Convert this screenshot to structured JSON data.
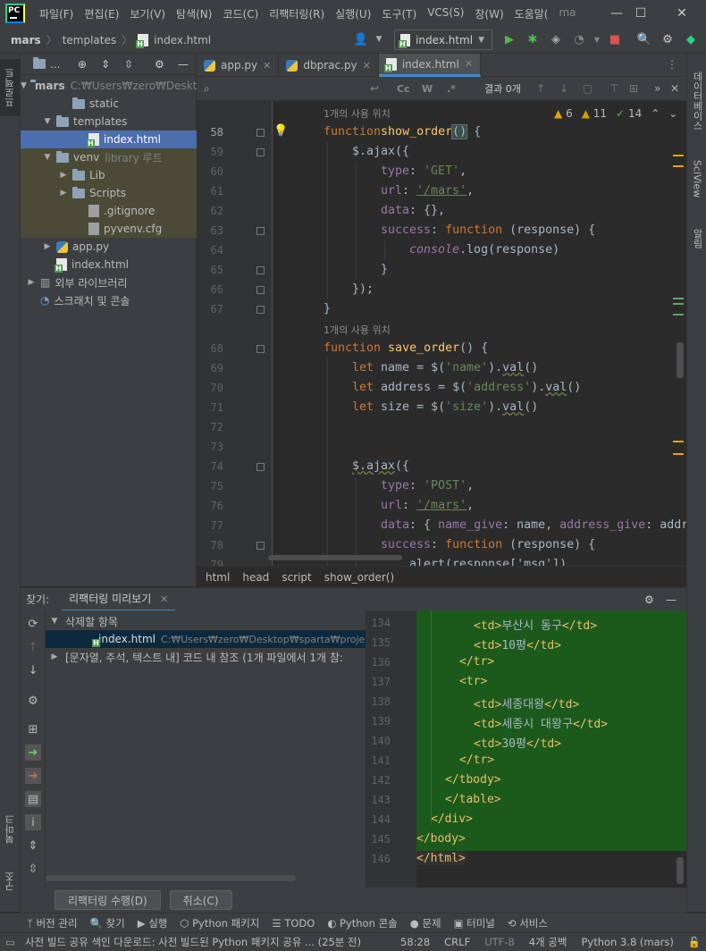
{
  "titlebar": {
    "logo": "PC",
    "menu": [
      "파일(F)",
      "편집(E)",
      "보기(V)",
      "탐색(N)",
      "코드(C)",
      "리팩터링(R)",
      "실행(U)",
      "도구(T)",
      "VCS(S)",
      "창(W)",
      "도움말(",
      "ma"
    ]
  },
  "navbar": {
    "crumbs": [
      "mars",
      "templates",
      "index.html"
    ],
    "run_config": "index.html"
  },
  "left_strip": {
    "project_tab": "프로젝트",
    "bookmark_tab": "북마크",
    "structure_tab": "구조"
  },
  "right_strip": {
    "db_tab": "데이터베이스",
    "sciview_tab": "SciView",
    "notify_tab": "알림"
  },
  "project": {
    "header_icon": "...",
    "tree": [
      {
        "label": "mars",
        "extra": "C:₩Users₩zero₩Deskt",
        "type": "folder",
        "depth": 0,
        "arrow": "▼"
      },
      {
        "label": "static",
        "extra": "",
        "type": "folder",
        "depth": 2,
        "arrow": ""
      },
      {
        "label": "templates",
        "extra": "",
        "type": "folder",
        "depth": 1,
        "arrow": "▼"
      },
      {
        "label": "index.html",
        "extra": "",
        "type": "html",
        "depth": 3,
        "arrow": "",
        "selected": true
      },
      {
        "label": "venv",
        "extra": "library 루트",
        "type": "folder",
        "depth": 1,
        "arrow": "▼",
        "venv": true
      },
      {
        "label": "Lib",
        "extra": "",
        "type": "folder",
        "depth": 2,
        "arrow": "▶",
        "venv": true
      },
      {
        "label": "Scripts",
        "extra": "",
        "type": "folder",
        "depth": 2,
        "arrow": "▶",
        "venv": true
      },
      {
        "label": ".gitignore",
        "extra": "",
        "type": "gen",
        "depth": 3,
        "arrow": "",
        "venv": true
      },
      {
        "label": "pyvenv.cfg",
        "extra": "",
        "type": "gen",
        "depth": 3,
        "arrow": "",
        "venv": true
      },
      {
        "label": "app.py",
        "extra": "",
        "type": "py",
        "depth": 1,
        "arrow": "▶"
      },
      {
        "label": "index.html",
        "extra": "",
        "type": "html",
        "depth": 1,
        "arrow": ""
      },
      {
        "label": "외부 라이브러리",
        "extra": "",
        "type": "lib",
        "depth": 0,
        "arrow": "▶"
      },
      {
        "label": "스크래치 및 콘솔",
        "extra": "",
        "type": "scratch",
        "depth": 0,
        "arrow": ""
      }
    ]
  },
  "tabs": [
    {
      "label": "app.py",
      "active": false
    },
    {
      "label": "dbprac.py",
      "active": false
    },
    {
      "label": "index.html",
      "active": true
    }
  ],
  "search": {
    "placeholder": "",
    "result": "결과 0개",
    "cc": "Cc",
    "w": "W",
    "regex": ".*"
  },
  "inspections": {
    "warnings": "6",
    "weak": "11",
    "ok": "14"
  },
  "editor": {
    "hints": [
      {
        "text": "1개의 사용 위치",
        "row": 0
      },
      {
        "text": "1개의 사용 위치",
        "row": 11
      }
    ],
    "lines": [
      {
        "n": "58",
        "row": 1
      },
      {
        "n": "59",
        "row": 2
      },
      {
        "n": "60",
        "row": 3
      },
      {
        "n": "61",
        "row": 4
      },
      {
        "n": "62",
        "row": 5
      },
      {
        "n": "63",
        "row": 6
      },
      {
        "n": "64",
        "row": 7
      },
      {
        "n": "65",
        "row": 8
      },
      {
        "n": "66",
        "row": 9
      },
      {
        "n": "67",
        "row": 10
      },
      {
        "n": "68",
        "row": 12
      },
      {
        "n": "69",
        "row": 13
      },
      {
        "n": "70",
        "row": 14
      },
      {
        "n": "71",
        "row": 15
      },
      {
        "n": "72",
        "row": 16
      },
      {
        "n": "73",
        "row": 17
      },
      {
        "n": "74",
        "row": 18
      },
      {
        "n": "75",
        "row": 19
      },
      {
        "n": "76",
        "row": 20
      },
      {
        "n": "77",
        "row": 21
      },
      {
        "n": "78",
        "row": 22
      },
      {
        "n": "79",
        "row": 23
      }
    ],
    "code": {
      "l58": [
        "function",
        "show_order",
        "()",
        " {"
      ],
      "l59": [
        "$.ajax",
        "({"
      ],
      "l60": [
        "type",
        ": ",
        "'GET'",
        ","
      ],
      "l61": [
        "url",
        ": ",
        "'/mars'",
        ","
      ],
      "l62": [
        "data",
        ": {},"
      ],
      "l63": [
        "success",
        ": ",
        "function",
        " (response) {"
      ],
      "l64": [
        "console",
        ".log(response)"
      ],
      "l65": [
        "}"
      ],
      "l66": [
        "});"
      ],
      "l67": [
        "}"
      ],
      "l68": [
        "function",
        " save_order",
        "() {"
      ],
      "l69": [
        "let",
        " name = ",
        "$",
        "(",
        "'name'",
        ").",
        "val",
        "()"
      ],
      "l70": [
        "let",
        " address = ",
        "$",
        "(",
        "'address'",
        ").",
        "val",
        "()"
      ],
      "l71": [
        "let",
        " size = ",
        "$",
        "(",
        "'size'",
        ").",
        "val",
        "()"
      ],
      "l74": [
        "$.ajax",
        "({"
      ],
      "l75": [
        "type",
        ": ",
        "'POST'",
        ","
      ],
      "l76": [
        "url",
        ": ",
        "'/mars'",
        ","
      ],
      "l77": [
        "data",
        ": { ",
        "name_give",
        ": name, ",
        "address_give",
        ": addr"
      ],
      "l78": [
        "success",
        ": ",
        "function",
        " (response) {"
      ],
      "l79": [
        "alert(response['msg'])"
      ]
    }
  },
  "breadcrumbs": [
    "html",
    "head",
    "script",
    "show_order()"
  ],
  "find": {
    "label": "찾기:",
    "tab": "리팩터링 미리보기",
    "tree": {
      "group1": "삭제할 항목",
      "file": "index.html",
      "file_path": "C:₩Users₩zero₩Desktop₩sparta₩project₩m",
      "group2": "[문자열, 주석, 텍스트 내] 코드 내 참조  (1개 파일에서  1개 참:"
    },
    "preview": [
      {
        "n": "134",
        "indent": 4,
        "open": "<td>",
        "text": "부산시 동구",
        "close": "</td>"
      },
      {
        "n": "135",
        "indent": 4,
        "open": "<td>",
        "text": "10평",
        "close": "</td>"
      },
      {
        "n": "136",
        "indent": 3,
        "open": "</tr>",
        "text": "",
        "close": ""
      },
      {
        "n": "137",
        "indent": 3,
        "open": "<tr>",
        "text": "",
        "close": ""
      },
      {
        "n": "138",
        "indent": 4,
        "open": "<td>",
        "text": "세종대왕",
        "close": "</td>"
      },
      {
        "n": "139",
        "indent": 4,
        "open": "<td>",
        "text": "세종시 대왕구",
        "close": "</td>"
      },
      {
        "n": "140",
        "indent": 4,
        "open": "<td>",
        "text": "30평",
        "close": "</td>"
      },
      {
        "n": "141",
        "indent": 3,
        "open": "</tr>",
        "text": "",
        "close": ""
      },
      {
        "n": "142",
        "indent": 2,
        "open": "</tbody>",
        "text": "",
        "close": ""
      },
      {
        "n": "143",
        "indent": 2,
        "open": "</table>",
        "text": "",
        "close": ""
      },
      {
        "n": "144",
        "indent": 1,
        "open": "</div>",
        "text": "",
        "close": ""
      },
      {
        "n": "145",
        "indent": 0,
        "open": "</body>",
        "text": "",
        "close": ""
      },
      {
        "n": "146",
        "indent": 0,
        "open": "</html>",
        "text": "",
        "close": ""
      }
    ],
    "do_refactor": "리팩터링 수행(D)",
    "cancel": "취소(C)"
  },
  "toolstrip": [
    "버전 관리",
    "찾기",
    "실행",
    "Python 패키지",
    "TODO",
    "Python 콘솔",
    "문제",
    "터미널",
    "서비스"
  ],
  "status": {
    "message": "사전 빌드 공유 색인 다운로드: 사전 빌드된 Python 패키지 공유 ... (25분 전)",
    "position": "58:28",
    "line_sep": "CRLF",
    "encoding": "UTF-8",
    "indent": "4개 공백",
    "interpreter": "Python 3.8 (mars)"
  },
  "colors": {
    "accent": "#4a88c7",
    "selection": "#4b6eaf",
    "preview_bg": "#1c5a1c"
  }
}
